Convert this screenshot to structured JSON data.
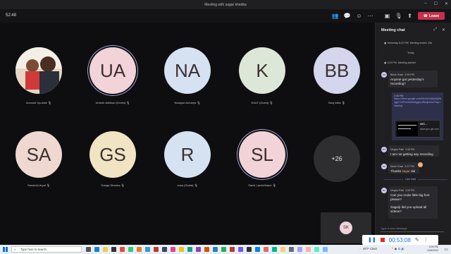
{
  "window": {
    "title": "Meeting with sagar khedka"
  },
  "meeting": {
    "timer": "52:48",
    "leave_label": "Leave"
  },
  "participants": [
    {
      "initials": "",
      "name": "Account Up-date",
      "color": "#f5e7ea",
      "photo": true,
      "speaking": false
    },
    {
      "initials": "UA",
      "name": "Umesh Adhikari (Guest)",
      "color": "#f2d3d8",
      "photo": false,
      "speaking": true
    },
    {
      "initials": "NA",
      "name": "Narayan Acharya",
      "color": "#d6e1f2",
      "photo": false,
      "speaking": false
    },
    {
      "initials": "K",
      "name": "KALE (Guest)",
      "color": "#dce7d8",
      "photo": false,
      "speaking": false
    },
    {
      "initials": "BB",
      "name": "Buuj kaila",
      "color": "#d4d6ee",
      "photo": false,
      "speaking": false
    },
    {
      "initials": "SA",
      "name": "Sandesh Aryal",
      "color": "#eed8cf",
      "photo": false,
      "speaking": false
    },
    {
      "initials": "GS",
      "name": "Ganga Sharma",
      "color": "#f0e4c3",
      "photo": false,
      "speaking": false
    },
    {
      "initials": "R",
      "name": "nosu (Guest)",
      "color": "#d5e2f1",
      "photo": false,
      "speaking": false
    },
    {
      "initials": "SL",
      "name": "Samir Lamichhane",
      "color": "#f2d3d8",
      "photo": false,
      "speaking": true
    }
  ],
  "overflow_label": "+26",
  "self_view": {
    "initials": "SK"
  },
  "chat": {
    "header": "Meeting chat",
    "meta1_time": "Yesterday 8:22 PM",
    "meta1_text": "Meeting ended: 29s",
    "day_label": "Today",
    "meta2_time": "3:23 PM",
    "meta2_text": "Meeting started",
    "msg1": {
      "initials": "BR",
      "author": "Bibek Rasé",
      "time": "3:35 PM",
      "text": "Anyone got yesterday's recording?"
    },
    "msg2": {
      "time": "3:36 PM",
      "link": "https://drive.google.com/file/d/1A38y9jQNiogpCVnPumeiMiA9gghy1Bedj/view?usp=sharing",
      "card_title": "GIT...",
      "card_source": "drive.goo gle.com"
    },
    "msg3": {
      "initials": "MP",
      "author": "Megha Patil",
      "time": "3:36 PM",
      "text": "I am not getting any recording"
    },
    "msg4": {
      "initials": "BR",
      "author": "Bibek Rasé",
      "time": "3:37 PM",
      "text_a": "Thanks ",
      "text_b": "sagar",
      "text_c": " dai"
    },
    "last_read": "Last read",
    "msg5": {
      "initials": "MP",
      "author": "Megha Patil",
      "time": "3:39 PM",
      "text": "Can you make little big font please?"
    },
    "msg6": {
      "text": "Sagarji did you upload all videos?"
    },
    "compose_placeholder": "Type a new message"
  },
  "recording": {
    "elapsed": "00:53:08"
  },
  "taskbar": {
    "search_placeholder": "Type here to search",
    "weather": "49°F  Clear",
    "time": "4:09 PM",
    "date": "1/28/2022"
  }
}
